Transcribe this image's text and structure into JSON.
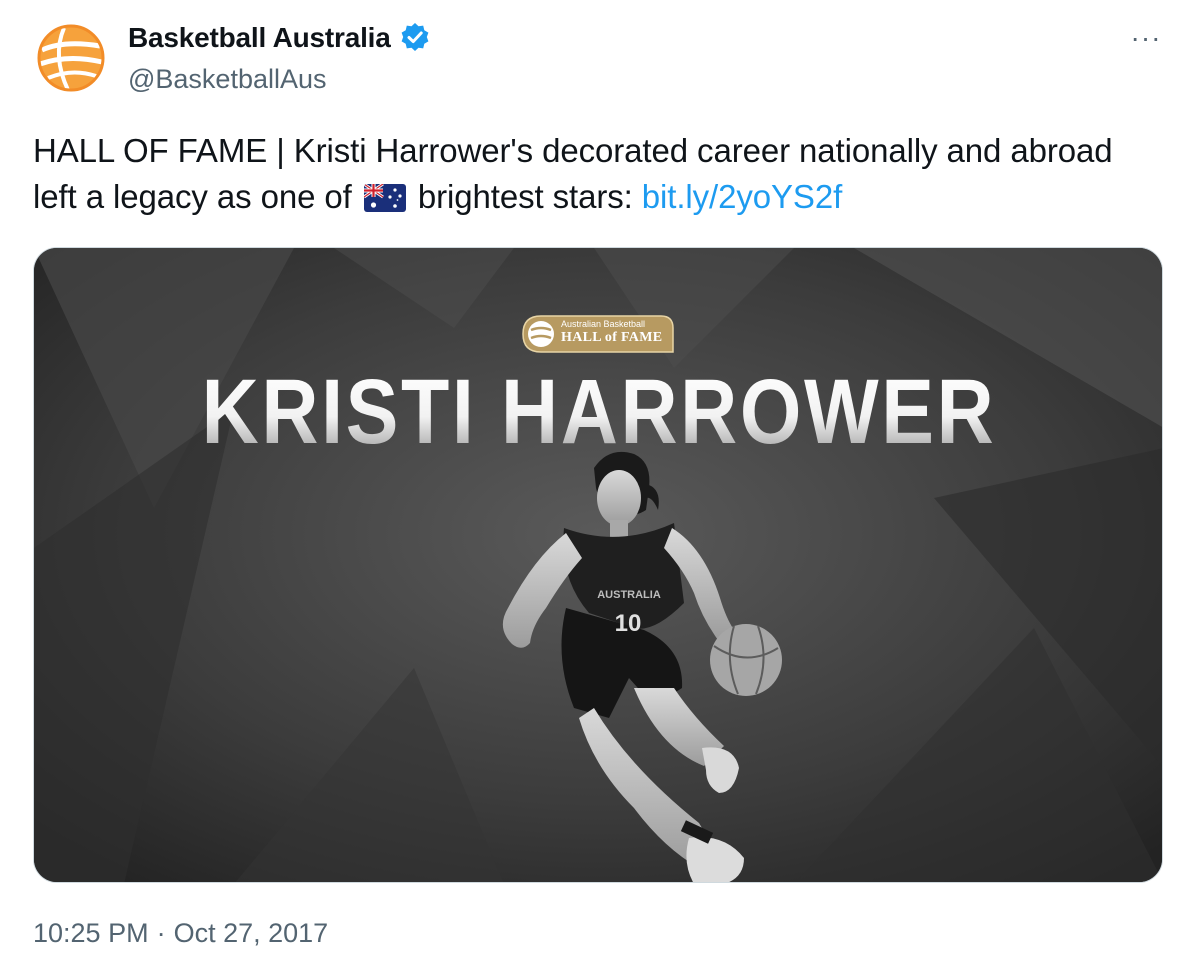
{
  "author": {
    "display_name": "Basketball Australia",
    "handle": "@BasketballAus",
    "verified": true,
    "avatar_icon": "basketball-logo-icon",
    "brand_color": "#f28c28"
  },
  "more_button": {
    "label": "···",
    "icon": "more-dots-icon"
  },
  "tweet": {
    "text_part1": "HALL OF FAME | Kristi Harrower's decorated career nationally and abroad left a legacy as one of ",
    "flag_icon": "australia-flag-icon",
    "text_part2": " brightest stars: ",
    "link_text": "bit.ly/2yoYS2f",
    "link_color": "#1d9bf0"
  },
  "media": {
    "badge_line1": "Australian Basketball",
    "badge_line2": "HALL of FAME",
    "headline": "KRISTI HARROWER",
    "jersey_text": "AUSTRALIA",
    "jersey_number": "10",
    "badge_color": "#b79a61"
  },
  "footer": {
    "time": "10:25 PM",
    "separator": "·",
    "date": "Oct 27, 2017"
  }
}
